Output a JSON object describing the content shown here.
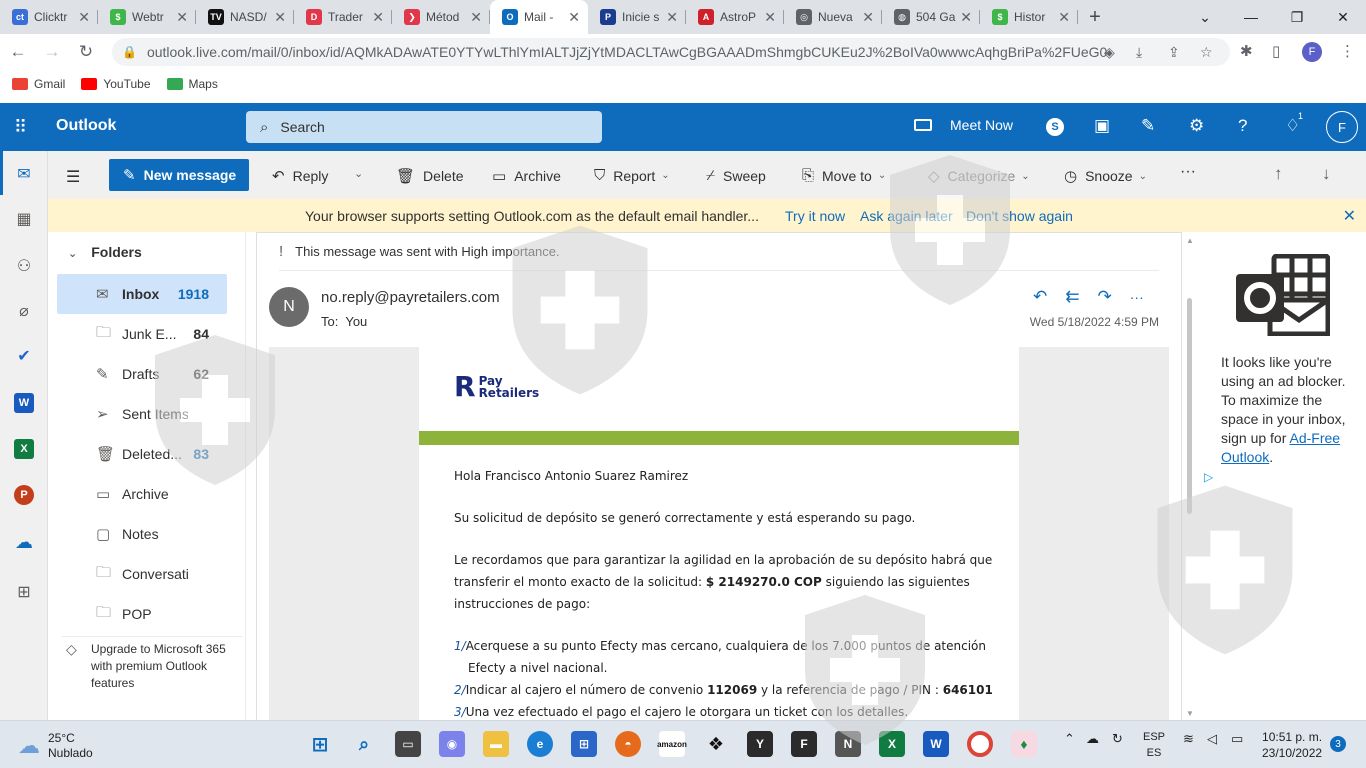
{
  "browser": {
    "tabs": [
      {
        "label": "Clicktr",
        "color": "#3b6fd8",
        "glyph": "ct",
        "active": false
      },
      {
        "label": "Webtr",
        "color": "#3fb54a",
        "glyph": "$",
        "active": false
      },
      {
        "label": "NASD/",
        "color": "#111111",
        "glyph": "TV",
        "active": false
      },
      {
        "label": "Trader",
        "color": "#e0374a",
        "glyph": "D",
        "active": false
      },
      {
        "label": "Métod",
        "color": "#e0374a",
        "glyph": "❯",
        "active": false
      },
      {
        "label": "Mail -",
        "color": "#0f6cbd",
        "glyph": "O",
        "active": true
      },
      {
        "label": "Inicie s",
        "color": "#1b3c8f",
        "glyph": "P",
        "active": false
      },
      {
        "label": "AstroP",
        "color": "#d0202a",
        "glyph": "A",
        "active": false
      },
      {
        "label": "Nueva",
        "color": "#5f6368",
        "glyph": "◎",
        "active": false
      },
      {
        "label": "504 Ga",
        "color": "#5f6368",
        "glyph": "◍",
        "active": false
      },
      {
        "label": "Histor",
        "color": "#3fb54a",
        "glyph": "$",
        "active": false
      }
    ],
    "new_tab": "+",
    "url": "outlook.live.com/mail/0/inbox/id/AQMkADAwATE0YTYwLThlYmIALTJjZjYtMDACLTAwCgBGAAADmShmgbCUKEu2J%2BoIVa0wwwcAqhgBriPa%2FUeG0n8...",
    "profile_initial": "F",
    "bookmarks": [
      {
        "label": "Gmail",
        "color": "#ea4335"
      },
      {
        "label": "YouTube",
        "color": "#ff0000"
      },
      {
        "label": "Maps",
        "color": "#34a853"
      }
    ]
  },
  "outlook": {
    "app_name": "Outlook",
    "search_placeholder": "Search",
    "meet_now": "Meet Now",
    "user_initial": "F",
    "notification_count": "1",
    "new_message": "New message",
    "commands": {
      "reply": "Reply",
      "delete": "Delete",
      "archive": "Archive",
      "report": "Report",
      "sweep": "Sweep",
      "move_to": "Move to",
      "categorize": "Categorize",
      "snooze": "Snooze",
      "more": "···"
    },
    "banner": {
      "message": "Your browser supports setting Outlook.com as the default email handler...",
      "try_it": "Try it now",
      "ask_later": "Ask again later",
      "dont_show": "Don't show again"
    },
    "folders_title": "Folders",
    "folders": [
      {
        "name": "Inbox",
        "count": "1918"
      },
      {
        "name": "Junk E...",
        "count": "84"
      },
      {
        "name": "Drafts",
        "count": "62"
      },
      {
        "name": "Sent Items",
        "count": ""
      },
      {
        "name": "Deleted...",
        "count": "83"
      },
      {
        "name": "Archive",
        "count": ""
      },
      {
        "name": "Notes",
        "count": ""
      },
      {
        "name": "Conversati...",
        "count": ""
      },
      {
        "name": "POP",
        "count": ""
      }
    ],
    "upgrade": "Upgrade to Microsoft 365 with premium Outlook features",
    "message": {
      "importance": "This message was sent with High importance.",
      "sender_initial": "N",
      "sender": "no.reply@payretailers.com",
      "to_label": "To:",
      "to": "You",
      "date": "Wed 5/18/2022 4:59 PM",
      "logo_line1": "Pay",
      "logo_line2": "Retailers",
      "greeting": "Hola Francisco Antonio Suarez Ramirez",
      "p1": "Su solicitud de depósito se generó correctamente y está esperando su pago.",
      "p2a": "Le recordamos que para garantizar la agilidad en la aprobación de su depósito habrá que transferir el monto exacto de la solicitud:",
      "amount": "$ 2149270.0 COP",
      "p2b": "siguiendo las siguientes instrucciones de pago:",
      "step1_num": "1/",
      "step1": "Acerquese a su punto Efecty mas cercano, cualquiera de los 7.000 puntos de atención Efecty a nivel nacional.",
      "step2_num": "2/",
      "step2a": "Indicar al cajero el número de convenio",
      "convenio": "112069",
      "step2b": "y la referencia de pago / PIN :",
      "pin": "646101",
      "step3_num": "3/",
      "step3": "Una vez efectuado el pago el cajero le otorgara un ticket con los detalles."
    },
    "ad": {
      "text": "It looks like you're using an ad blocker. To maximize the space in your inbox, sign up for",
      "link": "Ad-Free Outlook",
      "period": "."
    }
  },
  "taskbar": {
    "temp": "25°C",
    "condition": "Nublado",
    "lang1": "ESP",
    "lang2": "ES",
    "time": "10:51 p. m.",
    "date": "23/10/2022",
    "notifications": "3"
  }
}
